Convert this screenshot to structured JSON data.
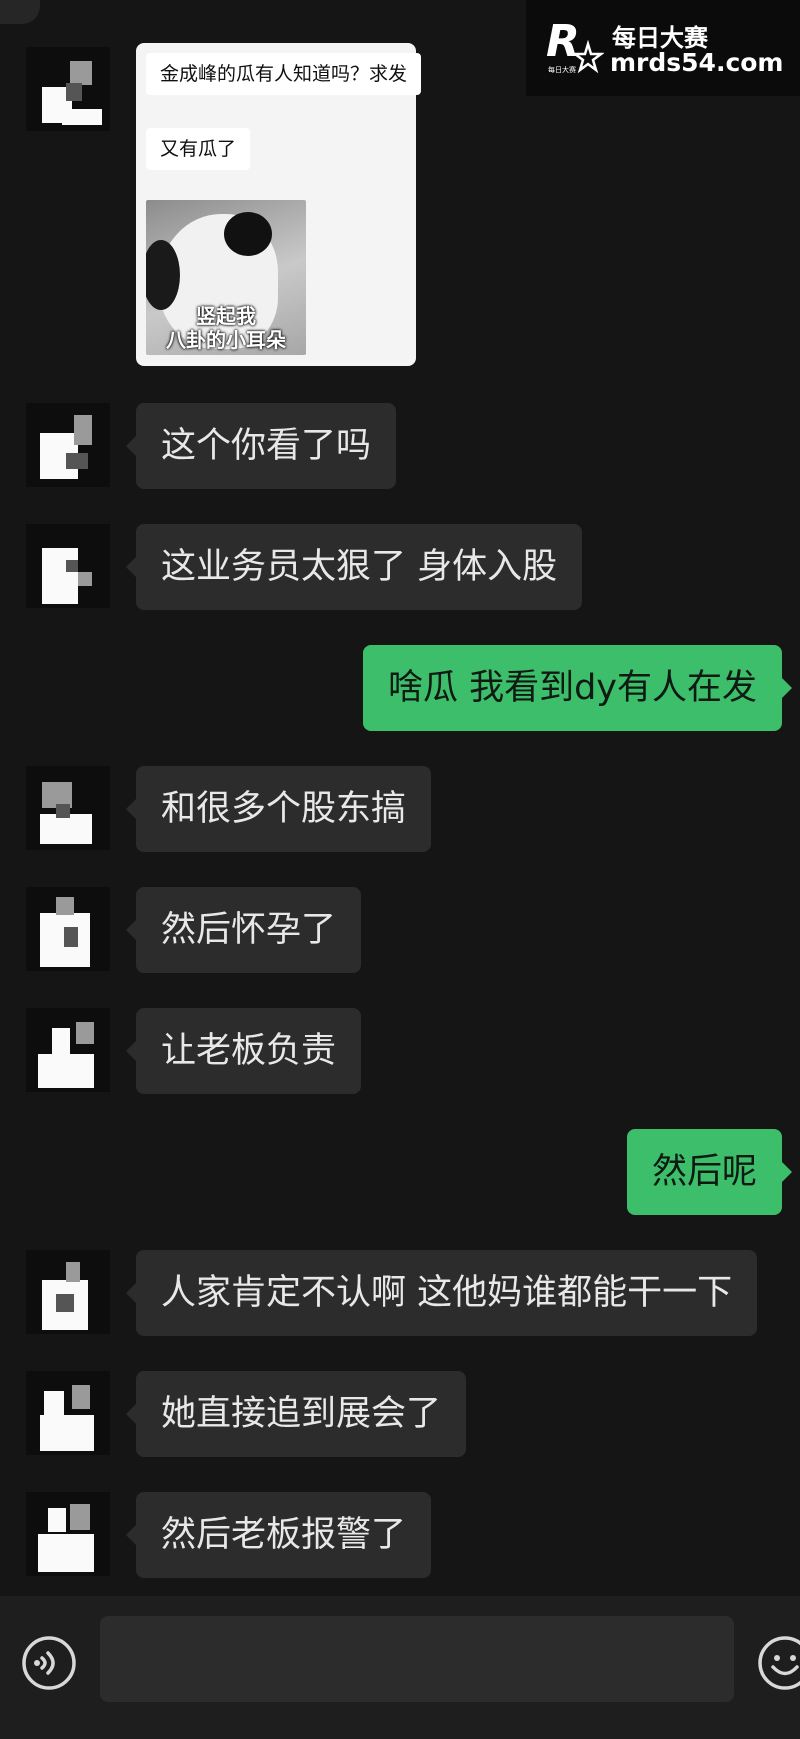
{
  "watermark": {
    "title": "每日大赛",
    "url": "mrds54.com",
    "logo_letter": "R",
    "logo_small": "每日大赛"
  },
  "quote": {
    "line1": "金成峰的瓜有人知道吗？求发",
    "line2": "又有瓜了",
    "sticker_line1": "竖起我",
    "sticker_line2": "八卦的小耳朵"
  },
  "messages": [
    {
      "from": "other",
      "text": "这个你看了吗"
    },
    {
      "from": "other",
      "text": "这业务员太狠了 身体入股"
    },
    {
      "from": "me",
      "text": "啥瓜 我看到dy有人在发"
    },
    {
      "from": "other",
      "text": "和很多个股东搞"
    },
    {
      "from": "other",
      "text": "然后怀孕了"
    },
    {
      "from": "other",
      "text": "让老板负责"
    },
    {
      "from": "me",
      "text": "然后呢"
    },
    {
      "from": "other",
      "text": "人家肯定不认啊 这他妈谁都能干一下"
    },
    {
      "from": "other",
      "text": "她直接追到展会了"
    },
    {
      "from": "other",
      "text": "然后老板报警了"
    }
  ],
  "icons": {
    "voice": "voice-icon",
    "emoji": "emoji-icon"
  },
  "colors": {
    "background": "#151515",
    "bubble_other": "#2c2c2c",
    "bubble_me": "#3dbe6b"
  }
}
